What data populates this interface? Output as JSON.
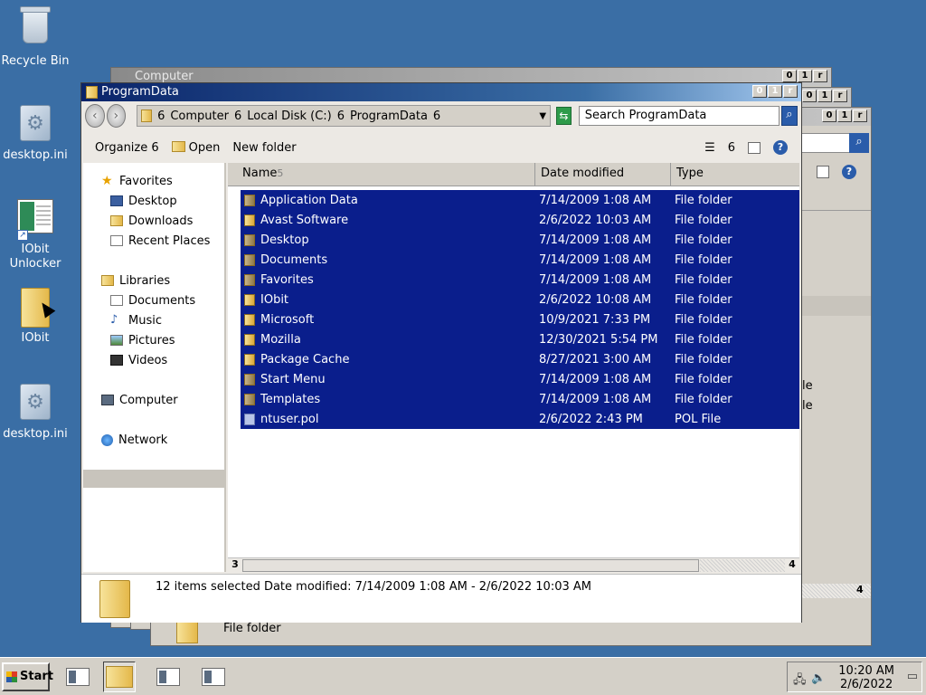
{
  "desktop": {
    "icons": [
      {
        "label": "Recycle Bin"
      },
      {
        "label": "desktop.ini"
      },
      {
        "label": "IObit Unlocker"
      },
      {
        "label": "IObit"
      },
      {
        "label": "desktop.ini"
      }
    ]
  },
  "back_windows": {
    "title": "Computer",
    "right_rows": [
      "le",
      "le"
    ],
    "bottom_type": "File folder",
    "scroll_arrow": "4"
  },
  "window": {
    "title": "ProgramData",
    "btn_min": "0",
    "btn_max": "1",
    "btn_close": "r",
    "back": "‹",
    "forward": "›",
    "breadcrumb": [
      "6",
      "Computer",
      "6",
      "Local Disk (C:)",
      "6",
      "ProgramData",
      "6"
    ],
    "search_placeholder": "Search ProgramData"
  },
  "toolbar": {
    "organize": "Organize",
    "organize_arrow": "6",
    "open": "Open",
    "new_folder": "New folder",
    "view_arrow": "6",
    "help": "?"
  },
  "nav": {
    "favorites": "Favorites",
    "desktop": "Desktop",
    "downloads": "Downloads",
    "recent": "Recent Places",
    "libraries": "Libraries",
    "documents": "Documents",
    "music": "Music",
    "pictures": "Pictures",
    "videos": "Videos",
    "computer": "Computer",
    "network": "Network"
  },
  "columns": {
    "name": "Name",
    "name_sort": "5",
    "date": "Date modified",
    "type": "Type"
  },
  "files": [
    {
      "name": "Application Data",
      "date": "7/14/2009 1:08 AM",
      "type": "File folder"
    },
    {
      "name": "Avast Software",
      "date": "2/6/2022 10:03 AM",
      "type": "File folder"
    },
    {
      "name": "Desktop",
      "date": "7/14/2009 1:08 AM",
      "type": "File folder"
    },
    {
      "name": "Documents",
      "date": "7/14/2009 1:08 AM",
      "type": "File folder"
    },
    {
      "name": "Favorites",
      "date": "7/14/2009 1:08 AM",
      "type": "File folder"
    },
    {
      "name": "IObit",
      "date": "2/6/2022 10:08 AM",
      "type": "File folder"
    },
    {
      "name": "Microsoft",
      "date": "10/9/2021 7:33 PM",
      "type": "File folder"
    },
    {
      "name": "Mozilla",
      "date": "12/30/2021 5:54 PM",
      "type": "File folder"
    },
    {
      "name": "Package Cache",
      "date": "8/27/2021 3:00 AM",
      "type": "File folder"
    },
    {
      "name": "Start Menu",
      "date": "7/14/2009 1:08 AM",
      "type": "File folder"
    },
    {
      "name": "Templates",
      "date": "7/14/2009 1:08 AM",
      "type": "File folder"
    },
    {
      "name": "ntuser.pol",
      "date": "2/6/2022 2:43 PM",
      "type": "POL File"
    }
  ],
  "scroll": {
    "left": "3",
    "right": "4"
  },
  "status": {
    "text": "12 items selected  Date modified: 7/14/2009 1:08 AM - 2/6/2022 10:03 AM"
  },
  "taskbar": {
    "start": "Start",
    "time": "10:20 AM",
    "date": "2/6/2022"
  }
}
